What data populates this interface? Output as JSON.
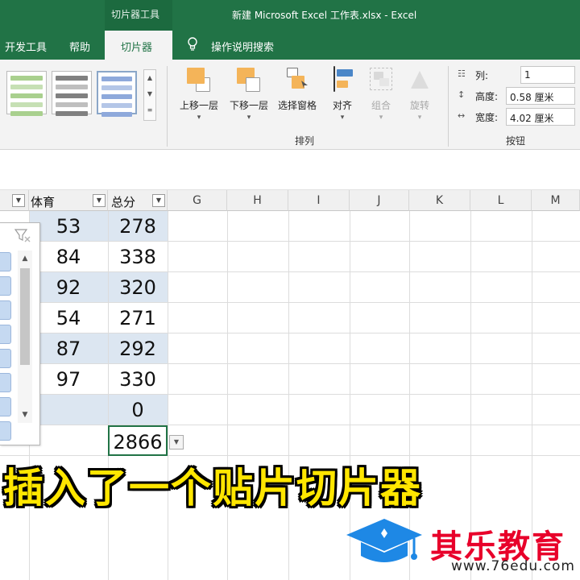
{
  "window": {
    "context_tab_group": "切片器工具",
    "title": "新建 Microsoft Excel 工作表.xlsx  -  Excel"
  },
  "ribbon_tabs": {
    "developer": "开发工具",
    "help": "帮助",
    "slicer": "切片器",
    "tell_me": "操作说明搜索"
  },
  "arrange": {
    "bring_forward": "上移一层",
    "send_backward": "下移一层",
    "selection_pane": "选择窗格",
    "align": "对齐",
    "group": "组合",
    "rotate": "旋转",
    "group_label": "排列"
  },
  "buttons_group": {
    "columns_label": "列:",
    "columns_value": "1",
    "height_label": "高度:",
    "height_value": "0.58 厘米",
    "width_label": "宽度:",
    "width_value": "4.02 厘米",
    "group_label": "按钮"
  },
  "sheet": {
    "header_sports": "体育",
    "header_total": "总分",
    "columns": [
      "G",
      "H",
      "I",
      "J",
      "K",
      "L",
      "M"
    ],
    "rows": [
      {
        "sports": "53",
        "total": "278"
      },
      {
        "sports": "84",
        "total": "338"
      },
      {
        "sports": "92",
        "total": "320"
      },
      {
        "sports": "54",
        "total": "271"
      },
      {
        "sports": "87",
        "total": "292"
      },
      {
        "sports": "97",
        "total": "330"
      },
      {
        "sports": "",
        "total": "0"
      }
    ],
    "grand_total": "2866"
  },
  "caption": "插入了一个贴片切片器",
  "watermark": {
    "brand": "其乐教育",
    "url": "www.76edu.com"
  },
  "colors": {
    "excel_green": "#217346",
    "row_band": "#dce6f1",
    "caption_yellow": "#ffe600",
    "brand_red": "#e8002a",
    "logo_blue": "#1e88e5"
  }
}
